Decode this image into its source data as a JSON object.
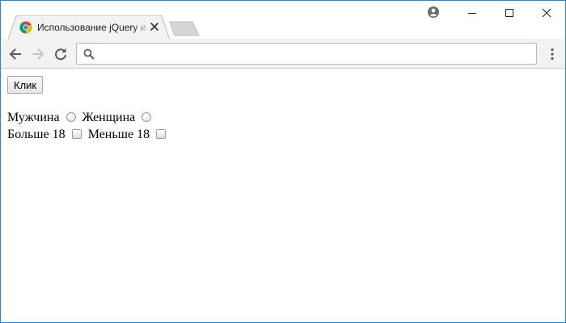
{
  "browser": {
    "tab": {
      "title": "Использование jQuery и JavaScript",
      "favicon": "chrome-favicon",
      "close_icon": "close-icon"
    },
    "new_tab_icon": "new-tab-icon",
    "profile_icon": "account-icon",
    "window_controls": [
      "minimize-icon",
      "maximize-icon",
      "close-icon"
    ],
    "toolbar": {
      "back_icon": "arrow-left-icon",
      "forward_icon": "arrow-right-icon",
      "reload_icon": "reload-icon",
      "menu_icon": "more-vert-icon"
    },
    "omnibox": {
      "value": "",
      "placeholder": "",
      "search_icon": "search-icon"
    }
  },
  "page": {
    "click_button": "Клик",
    "gender": {
      "male_label": "Мужчина",
      "female_label": "Женщина",
      "male_checked": false,
      "female_checked": false
    },
    "age": {
      "over_label": "Больше 18",
      "under_label": "Меньше 18",
      "over_checked": false,
      "under_checked": false
    }
  },
  "colors": {
    "window_border": "#1e88d8",
    "toolbar_bg": "#f2f2f2",
    "tab_bg": "#f2f2f2"
  }
}
